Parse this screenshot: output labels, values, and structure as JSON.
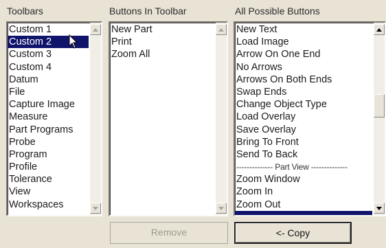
{
  "labels": {
    "toolbars": "Toolbars",
    "buttons_in_toolbar": "Buttons In Toolbar",
    "all_possible_buttons": "All Possible Buttons"
  },
  "toolbars": {
    "selected": "Custom 2",
    "items": [
      "Custom 1",
      "Custom 2",
      "Custom 3",
      "Custom 4",
      "Datum",
      "File",
      "Capture Image",
      "Measure",
      "Part Programs",
      "Probe",
      "Program",
      "Profile",
      "Tolerance",
      "View",
      "Workspaces"
    ]
  },
  "buttons_in_toolbar": {
    "items": [
      "New Part",
      "Print",
      "Zoom All"
    ]
  },
  "all_possible_buttons": {
    "items": [
      "New Text",
      "Load Image",
      "Arrow On One End",
      "No Arrows",
      "Arrows On Both Ends",
      "Swap Ends",
      "Change Object Type",
      "Load Overlay",
      "Save Overlay",
      "Bring To Front",
      "Send To Back",
      "-------------- Part View --------------",
      "Zoom Window",
      "Zoom In",
      "Zoom Out"
    ]
  },
  "actions": {
    "remove": "Remove",
    "copy": "<- Copy"
  },
  "icons": {
    "scroll_up": "arrow-up-icon",
    "scroll_down": "arrow-down-icon",
    "cursor": "mouse-pointer-icon"
  },
  "colors": {
    "selection": "#10146b",
    "background": "#e9e3d6"
  }
}
